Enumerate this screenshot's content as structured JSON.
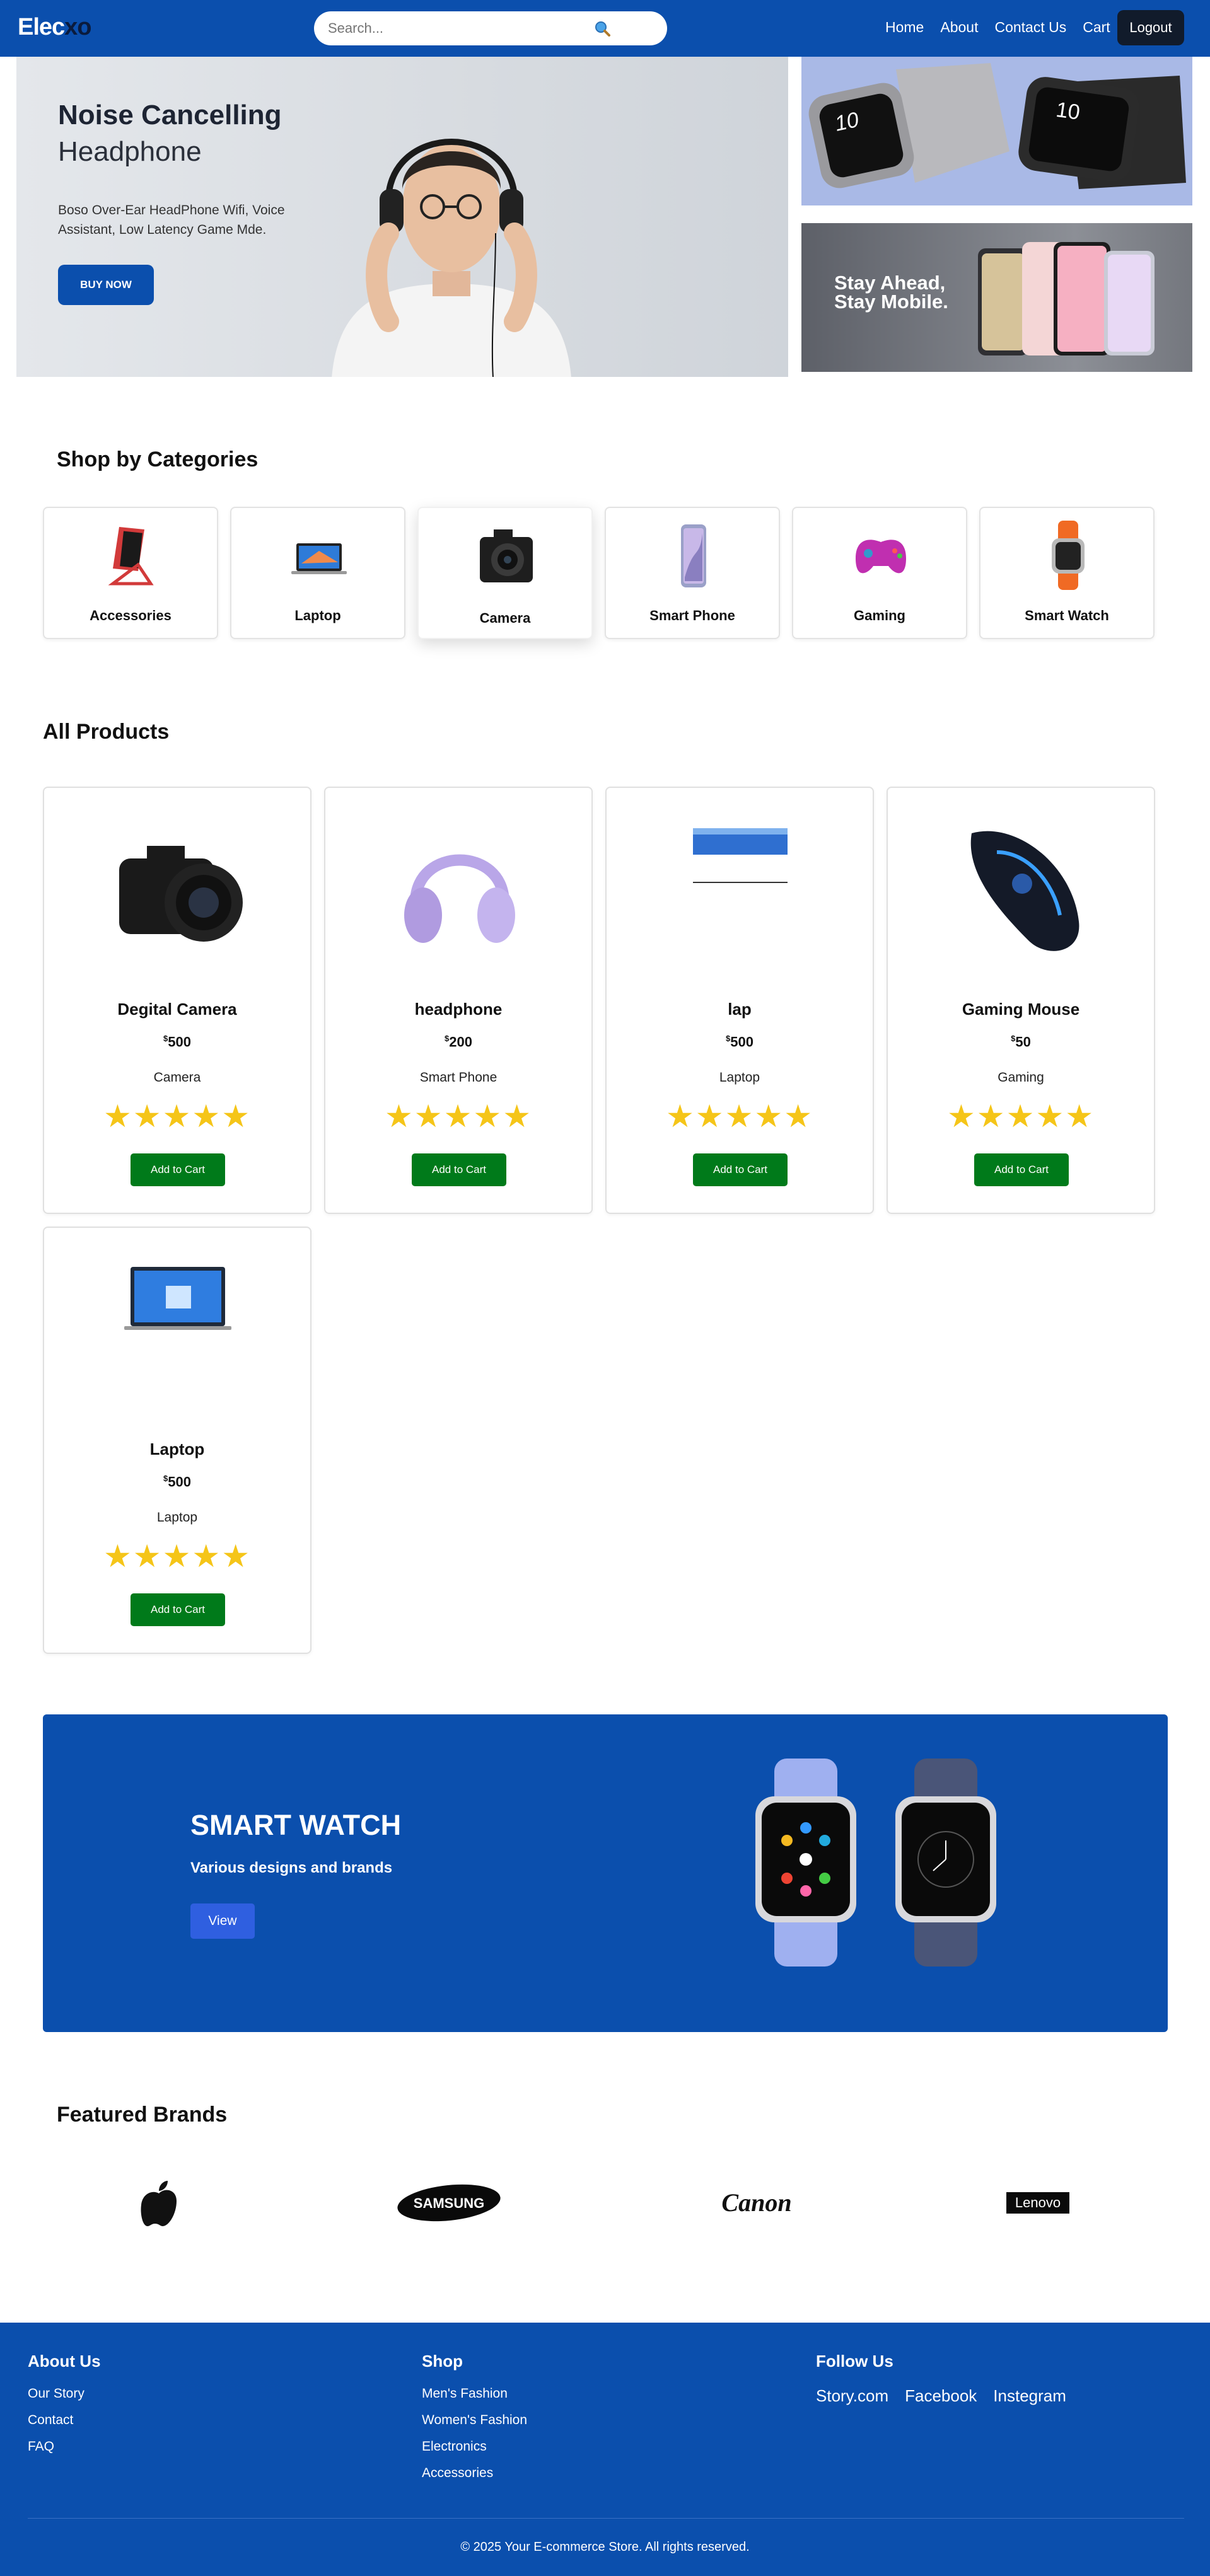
{
  "nav": {
    "logo_main": "Elec",
    "logo_accent": "xo",
    "search_placeholder": "Search...",
    "links": [
      "Home",
      "About",
      "Contact Us",
      "Cart"
    ],
    "logout": "Logout"
  },
  "hero": {
    "title": "Noise Cancelling",
    "subtitle": "Headphone",
    "description": "Boso Over-Ear HeadPhone Wifi, Voice Assistant, Low Latency Game Mde.",
    "button": "BUY NOW",
    "promo2_line1": "Stay Ahead,",
    "promo2_line2": "Stay Mobile.",
    "watch_time_1": "10",
    "watch_time_2": "10"
  },
  "categories": {
    "title": "Shop by Categories",
    "items": [
      "Accessories",
      "Laptop",
      "Camera",
      "Smart Phone",
      "Gaming",
      "Smart Watch"
    ],
    "active_index": 2
  },
  "products": {
    "title": "All Products",
    "currency": "$",
    "add_label": "Add to Cart",
    "items": [
      {
        "name": "Degital Camera",
        "price": "500",
        "category": "Camera",
        "rating": 5
      },
      {
        "name": "headphone",
        "price": "200",
        "category": "Smart Phone",
        "rating": 5
      },
      {
        "name": "lap",
        "price": "500",
        "category": "Laptop",
        "rating": 5
      },
      {
        "name": "Gaming Mouse",
        "price": "50",
        "category": "Gaming",
        "rating": 5
      },
      {
        "name": "Laptop",
        "price": "500",
        "category": "Laptop",
        "rating": 5
      }
    ]
  },
  "banner": {
    "title": "SMART WATCH",
    "subtitle": "Various designs and brands",
    "button": "View"
  },
  "brands": {
    "title": "Featured Brands",
    "samsung": "SAMSUNG",
    "canon": "Canon",
    "lenovo": "Lenovo"
  },
  "footer": {
    "about_title": "About Us",
    "about_links": [
      "Our Story",
      "Contact",
      "FAQ"
    ],
    "shop_title": "Shop",
    "shop_links": [
      "Men's Fashion",
      "Women's Fashion",
      "Electronics",
      "Accessories"
    ],
    "follow_title": "Follow Us",
    "follow_links": [
      "Story.com",
      "Facebook",
      "Instegram"
    ],
    "copyright": "© 2025 Your E-commerce Store. All rights reserved."
  },
  "colors": {
    "brand_blue": "#0b4fad",
    "add_green": "#007a1a",
    "star_yellow": "#f5c518"
  }
}
